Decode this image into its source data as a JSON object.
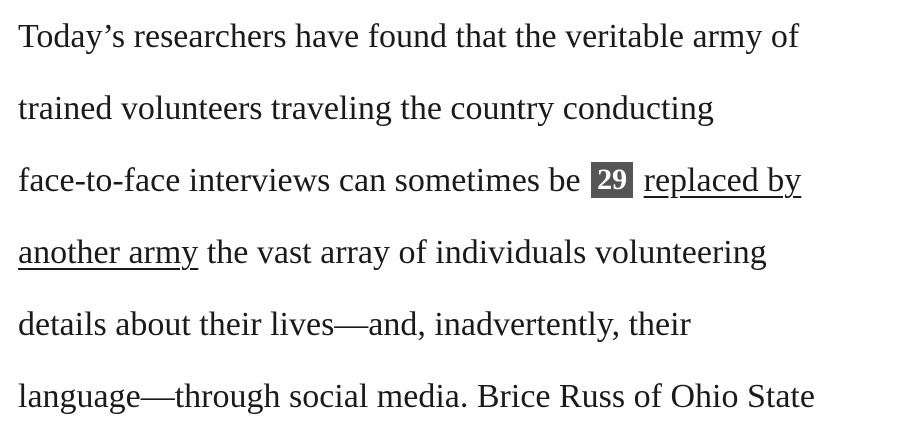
{
  "passage": {
    "line1": "Today’s researchers have found that the veritable army of",
    "line2": "trained volunteers traveling the country conducting",
    "line3_text": "face-to-face interviews can sometimes be ",
    "question_number": "29",
    "underlined_part1": "replaced by",
    "underlined_part2": "another army",
    "line4_rest": " the vast array of individuals volunteering",
    "line5": "details about their lives—and, inadvertently, their",
    "line6": "language—through social media. Brice Russ of Ohio State"
  },
  "colors": {
    "text": "#1a1a1a",
    "question_box": "#555555",
    "question_text": "#ffffff"
  }
}
